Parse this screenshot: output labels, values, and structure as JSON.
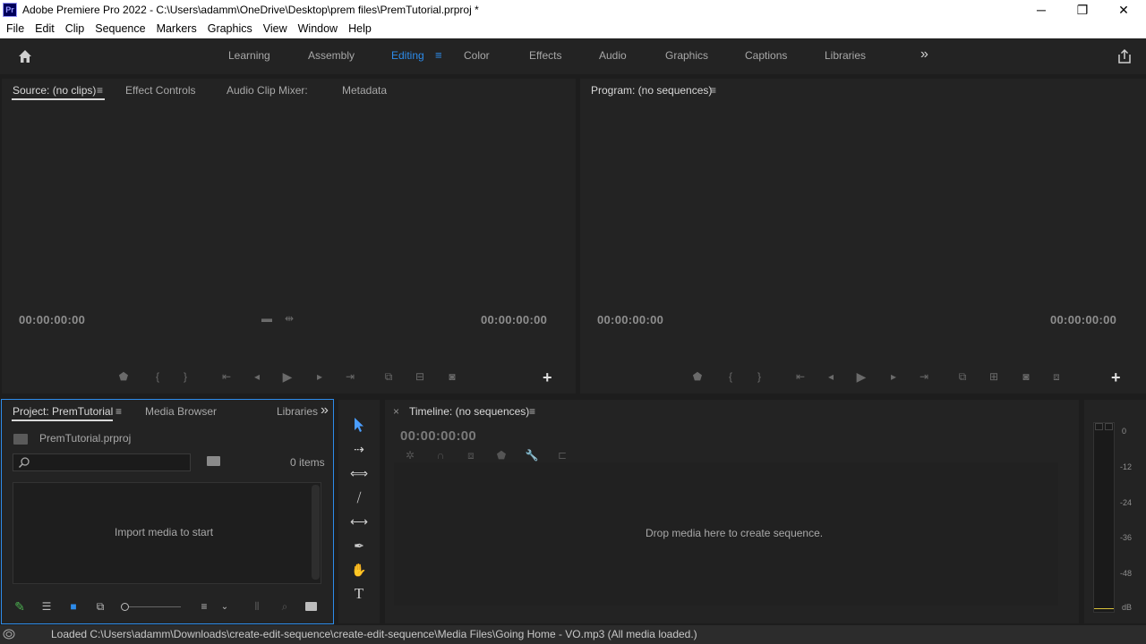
{
  "window": {
    "app_icon_text": "Pr",
    "title": "Adobe Premiere Pro 2022 - C:\\Users\\adamm\\OneDrive\\Desktop\\prem files\\PremTutorial.prproj *",
    "minimize": "─",
    "maximize": "❐",
    "close": "✕"
  },
  "menu": [
    "File",
    "Edit",
    "Clip",
    "Sequence",
    "Markers",
    "Graphics",
    "View",
    "Window",
    "Help"
  ],
  "workspaces": {
    "tabs": [
      "Learning",
      "Assembly",
      "Editing",
      "Color",
      "Effects",
      "Audio",
      "Graphics",
      "Captions",
      "Libraries"
    ],
    "active": "Editing",
    "more": "»"
  },
  "source_panel": {
    "tabs": [
      "Source: (no clips)",
      "Effect Controls",
      "Audio Clip Mixer:",
      "Metadata"
    ],
    "timecode_in": "00:00:00:00",
    "timecode_out": "00:00:00:00"
  },
  "program_panel": {
    "tab": "Program: (no sequences)",
    "timecode_in": "00:00:00:00",
    "timecode_out": "00:00:00:00"
  },
  "project_panel": {
    "tabs": [
      "Project: PremTutorial",
      "Media Browser",
      "Libraries"
    ],
    "more": "»",
    "file_name": "PremTutorial.prproj",
    "search_placeholder": "",
    "items_count": "0 items",
    "empty_message": "Import media to start"
  },
  "timeline_panel": {
    "close": "×",
    "tab": "Timeline: (no sequences)",
    "timecode": "00:00:00:00",
    "empty_message": "Drop media here to create sequence."
  },
  "audio_meter": {
    "labels": [
      "0",
      "-12",
      "-24",
      "-36",
      "-48",
      "dB"
    ]
  },
  "status": {
    "message": "Loaded C:\\Users\\adamm\\Downloads\\create-edit-sequence\\create-edit-sequence\\Media Files\\Going Home - VO.mp3 (All media loaded.)"
  },
  "colors": {
    "accent": "#2d8ceb",
    "panel_bg": "#232323",
    "app_bg": "#1d1d1d"
  }
}
